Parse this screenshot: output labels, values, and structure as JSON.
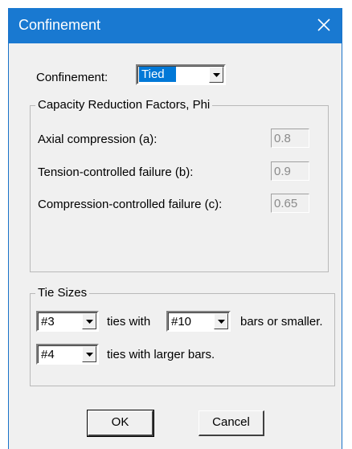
{
  "window": {
    "title": "Confinement",
    "close_symbol": "✕"
  },
  "confinement": {
    "label": "Confinement:",
    "selected": "Tied"
  },
  "capacity_group": {
    "legend": "Capacity Reduction Factors, Phi",
    "rows": [
      {
        "label": "Axial compression (a):",
        "value": "0.8"
      },
      {
        "label": "Tension-controlled failure (b):",
        "value": "0.9"
      },
      {
        "label": "Compression-controlled failure (c):",
        "value": "0.65"
      }
    ]
  },
  "tie_group": {
    "legend": "Tie Sizes",
    "row1": {
      "tie": "#3",
      "text1": "ties with",
      "bar": "#10",
      "text2": "bars or smaller."
    },
    "row2": {
      "tie": "#4",
      "text1": "ties with larger bars."
    }
  },
  "buttons": {
    "ok": "OK",
    "cancel": "Cancel"
  },
  "colors": {
    "titlebar": "#1979d1",
    "selection": "#0078d7",
    "dialog_bg": "#f0f0f0"
  }
}
